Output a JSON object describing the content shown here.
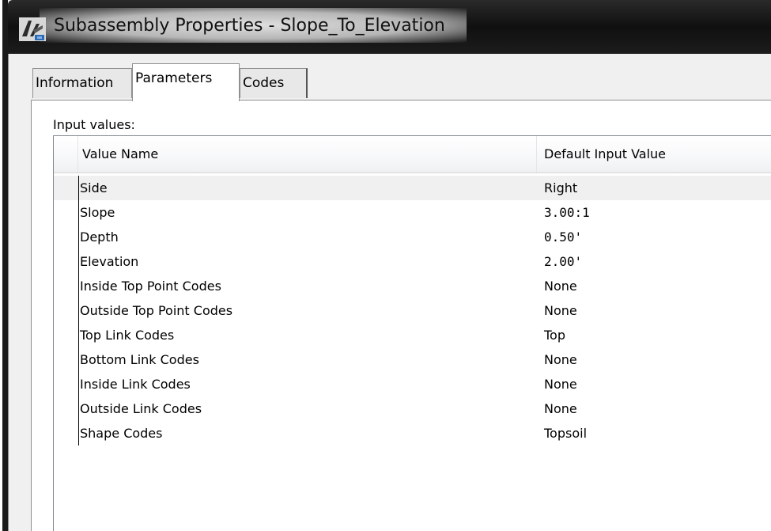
{
  "window": {
    "title": "Subassembly Properties - Slope_To_Elevation",
    "icon": "civil3d-app-icon"
  },
  "tabs": [
    {
      "label": "Information",
      "active": false
    },
    {
      "label": "Parameters",
      "active": true
    },
    {
      "label": "Codes",
      "active": false
    }
  ],
  "parameters": {
    "section_label": "Input values:",
    "columns": [
      "Value Name",
      "Default Input Value"
    ],
    "rows": [
      {
        "name": "Side",
        "value": "Right",
        "selected": true
      },
      {
        "name": "Slope",
        "value": "3.00:1"
      },
      {
        "name": "Depth",
        "value": "0.50'"
      },
      {
        "name": "Elevation",
        "value": "2.00'"
      },
      {
        "name": "Inside Top Point Codes",
        "value": "None"
      },
      {
        "name": "Outside Top Point Codes",
        "value": "None"
      },
      {
        "name": "Top Link Codes",
        "value": "Top"
      },
      {
        "name": "Bottom Link Codes",
        "value": "None"
      },
      {
        "name": "Inside Link Codes",
        "value": "None"
      },
      {
        "name": "Outside Link Codes",
        "value": "None"
      },
      {
        "name": "Shape Codes",
        "value": "Topsoil"
      }
    ]
  }
}
